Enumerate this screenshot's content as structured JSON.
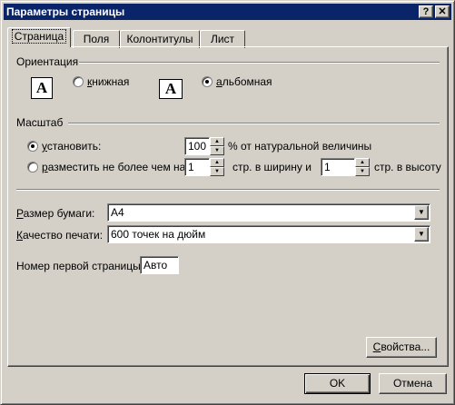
{
  "window": {
    "title": "Параметры страницы",
    "help_glyph": "?",
    "close_glyph": "✕"
  },
  "tabs": [
    {
      "label": "Страница",
      "active": true
    },
    {
      "label": "Поля",
      "active": false
    },
    {
      "label": "Колонтитулы",
      "active": false
    },
    {
      "label": "Лист",
      "active": false
    }
  ],
  "orientation": {
    "group_label": "Ориентация",
    "icon_glyph": "A",
    "portrait": {
      "accel": "к",
      "rest": "нижная",
      "selected": false
    },
    "landscape": {
      "accel": "а",
      "rest": "льбомная",
      "selected": true
    }
  },
  "scale": {
    "group_label": "Масштаб",
    "adjust": {
      "accel": "у",
      "rest": "становить:",
      "selected": true,
      "value": "100",
      "suffix": "% от натуральной величины"
    },
    "fit": {
      "accel": "р",
      "rest": "азместить не более чем на:",
      "selected": false,
      "wide_value": "1",
      "wide_suffix": "стр. в ширину и",
      "tall_value": "1",
      "tall_suffix": "стр. в высоту"
    }
  },
  "paper_size": {
    "accel": "Р",
    "rest": "азмер бумаги:",
    "value": "A4"
  },
  "print_quality": {
    "accel": "К",
    "rest": "ачество печати:",
    "value": "600 точек на дюйм"
  },
  "first_page_number": {
    "label": "Номер первой страницы:",
    "value": "Авто"
  },
  "buttons": {
    "properties": {
      "accel": "С",
      "rest": "войства..."
    },
    "ok": "OK",
    "cancel": "Отмена"
  },
  "colors": {
    "titlebar": "#0a246a",
    "face": "#d4d0c8"
  }
}
